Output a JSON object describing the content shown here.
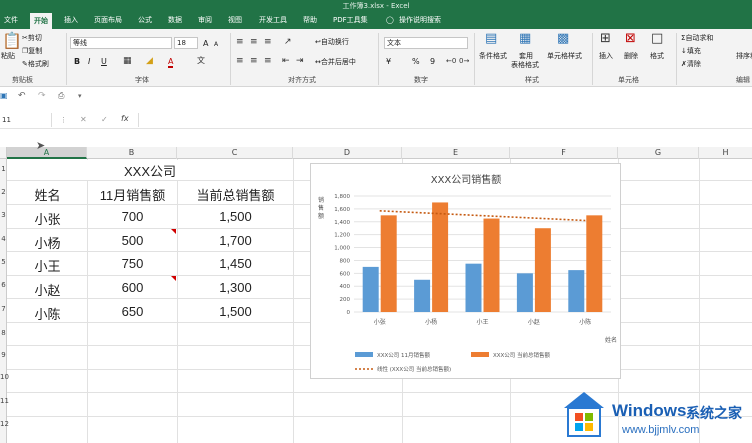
{
  "window": {
    "title": "工作簿3.xlsx  -  Excel"
  },
  "tabs": [
    "文件",
    "开始",
    "插入",
    "页面布局",
    "公式",
    "数据",
    "审阅",
    "视图",
    "开发工具",
    "帮助",
    "PDF工具集",
    "操作说明搜索"
  ],
  "ribbon": {
    "clipboard": {
      "paste": "粘贴",
      "cut": "剪切",
      "copy": "复制",
      "format_painter": "格式刷",
      "label": "剪贴板"
    },
    "font": {
      "name": "等线",
      "size": "18",
      "label": "字体",
      "bold": "B",
      "italic": "I",
      "underline": "U",
      "grow": "A",
      "shrink": "A",
      "font_color": "A"
    },
    "align": {
      "wrap": "自动换行",
      "merge": "合并后居中",
      "label": "对齐方式"
    },
    "number": {
      "format": "文本",
      "currency": "¥",
      "percent": "%",
      "comma": "9",
      "label": "数字"
    },
    "styles": {
      "cond": "条件格式",
      "table": "套用表格格式",
      "cell": "单元格样式",
      "label": "样式",
      "table1": "套用",
      "table2": "表格格式"
    },
    "cells": {
      "insert": "插入",
      "delete": "删除",
      "format": "格式",
      "label": "单元格"
    },
    "edit": {
      "autosum": "自动求和",
      "fill": "填充",
      "clear": "清除",
      "sort": "排序和",
      "label": "编辑"
    }
  },
  "namebox": "11",
  "fx": "fx",
  "columns": [
    "A",
    "B",
    "C",
    "D",
    "E",
    "F",
    "G",
    "H"
  ],
  "rows": [
    "1",
    "2",
    "3",
    "4",
    "5",
    "6",
    "7",
    "8",
    "9",
    "10",
    "11",
    "12"
  ],
  "sheet": {
    "title": "XXX公司",
    "headers": [
      "姓名",
      "11月销售额",
      "当前总销售额"
    ],
    "data": [
      [
        "小张",
        "700",
        "1,500"
      ],
      [
        "小杨",
        "500",
        "1,700"
      ],
      [
        "小王",
        "750",
        "1,450"
      ],
      [
        "小赵",
        "600",
        "1,300"
      ],
      [
        "小陈",
        "650",
        "1,500"
      ]
    ]
  },
  "chart_data": {
    "type": "bar",
    "title": "XXX公司销售额",
    "categories": [
      "小张",
      "小杨",
      "小王",
      "小赵",
      "小陈"
    ],
    "series": [
      {
        "name": "XXX公司 11月销售额",
        "values": [
          700,
          500,
          750,
          600,
          650
        ],
        "color": "#5b9bd5"
      },
      {
        "name": "XXX公司 当前总销售额",
        "values": [
          1500,
          1700,
          1450,
          1300,
          1500
        ],
        "color": "#ed7d31"
      }
    ],
    "trendline": {
      "name": "线性 (XXX公司 当前总销售额)",
      "color": "#c55a11",
      "start": 1570,
      "end": 1420
    },
    "ylim": [
      0,
      1800
    ],
    "yticks": [
      "0",
      "200",
      "400",
      "600",
      "800",
      "1,000",
      "1,200",
      "1,400",
      "1,600",
      "1,800"
    ],
    "xlabel": "姓名",
    "ylabel": "销售额",
    "grid": true,
    "legend": "bottom"
  },
  "watermark": {
    "brand": "Windows",
    "suffix": "系统之家",
    "url": "www.bjjmlv.com"
  }
}
